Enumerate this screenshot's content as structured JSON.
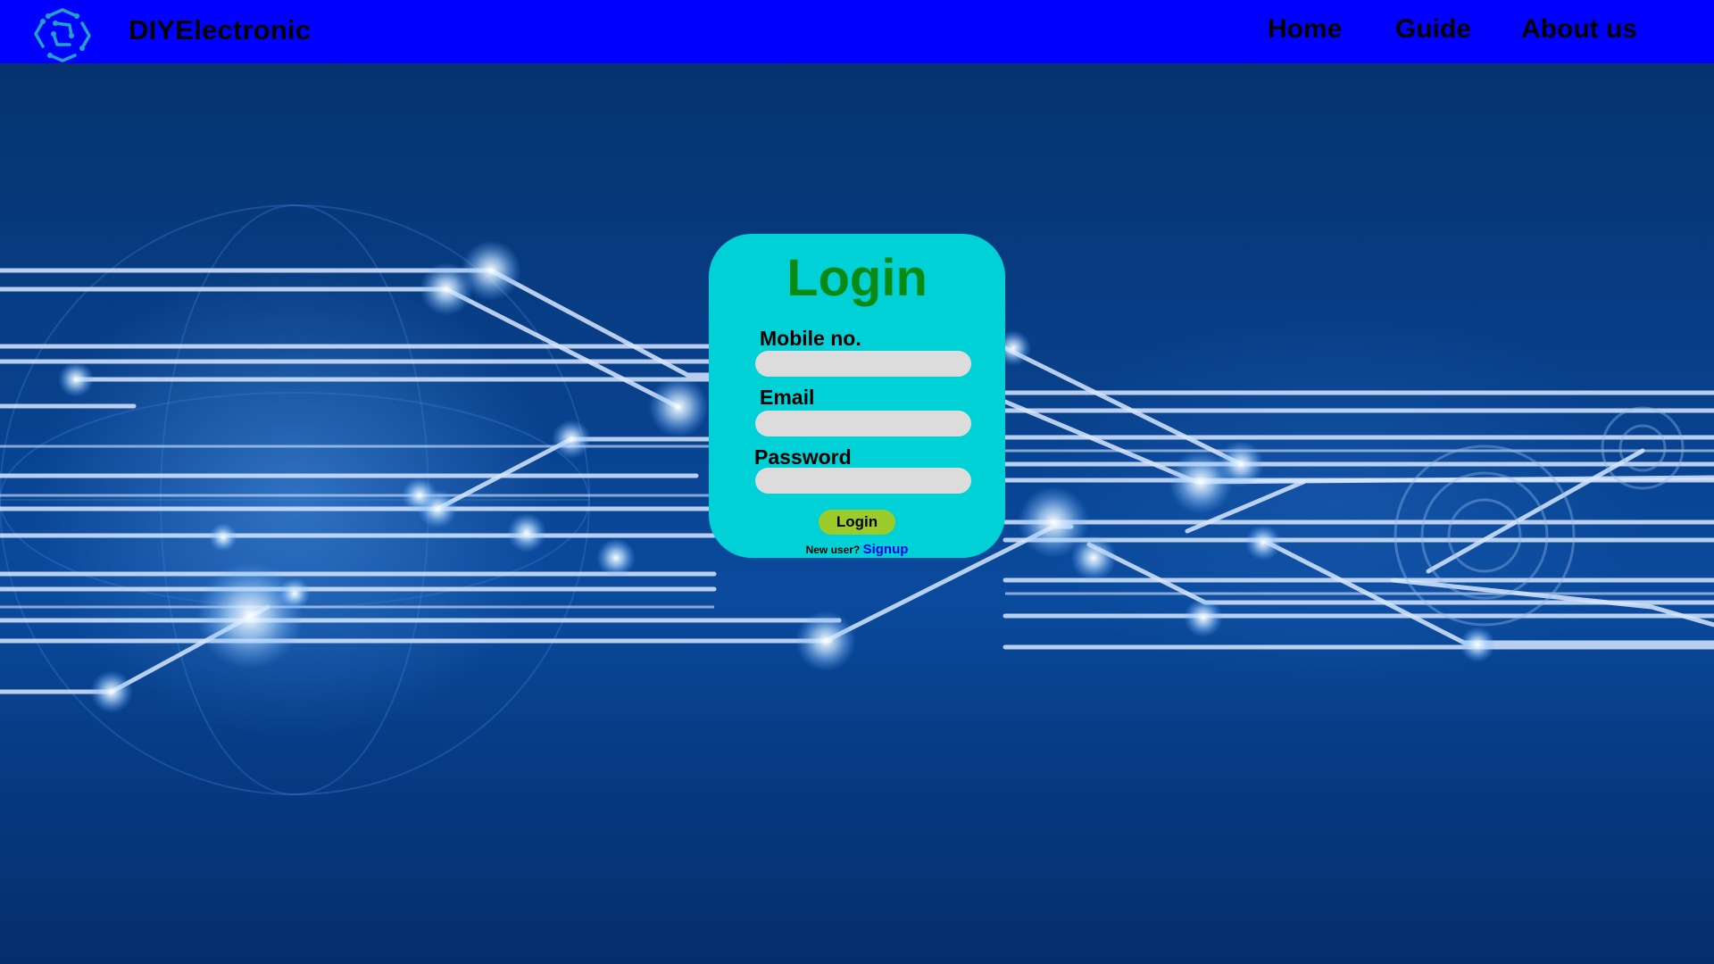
{
  "navbar": {
    "brand": "DIYElectronic",
    "logo_icon": "circuit-hexagon-logo-icon",
    "links": [
      "Home",
      "Guide",
      "About us"
    ]
  },
  "login": {
    "title": "Login",
    "fields": [
      {
        "label": "Mobile no.",
        "value": "",
        "placeholder": ""
      },
      {
        "label": "Email",
        "value": "",
        "placeholder": ""
      },
      {
        "label": "Password",
        "value": "",
        "placeholder": ""
      }
    ],
    "button_label": "Login",
    "new_user_text": "New user?",
    "signup_label": "Signup"
  },
  "colors": {
    "navbar": "#0000ff",
    "card": "#00d1d6",
    "title": "#0a8a12",
    "button": "#9ccc2c",
    "link": "#0000ee",
    "input": "#dcdcdc",
    "background": "#06357a"
  }
}
